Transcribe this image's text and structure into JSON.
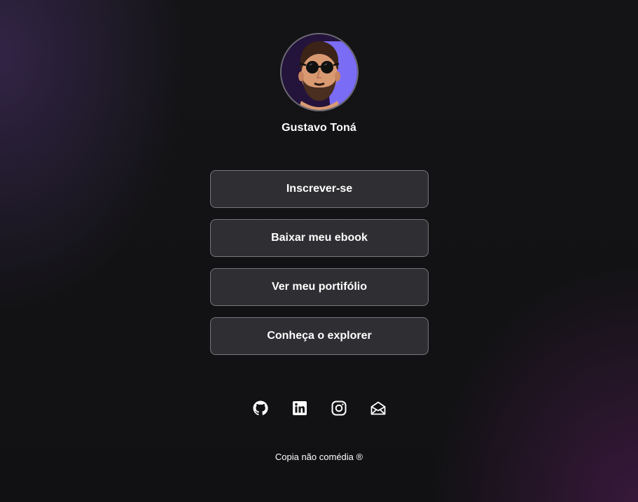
{
  "profile": {
    "name": "Gustavo Toná",
    "avatar_icon": "avatar-illustration"
  },
  "links": [
    {
      "label": "Inscrever-se"
    },
    {
      "label": "Baixar meu ebook"
    },
    {
      "label": "Ver meu portifólio"
    },
    {
      "label": "Conheça o explorer"
    }
  ],
  "socials": [
    {
      "icon": "github-icon"
    },
    {
      "icon": "linkedin-icon"
    },
    {
      "icon": "instagram-icon"
    },
    {
      "icon": "mail-icon"
    }
  ],
  "footer": {
    "text": "Copia não comédia ®"
  },
  "colors": {
    "background": "#141416",
    "button_bg": "#3a3a40",
    "button_border": "#75757c",
    "avatar_accent": "#7b6cf6"
  }
}
